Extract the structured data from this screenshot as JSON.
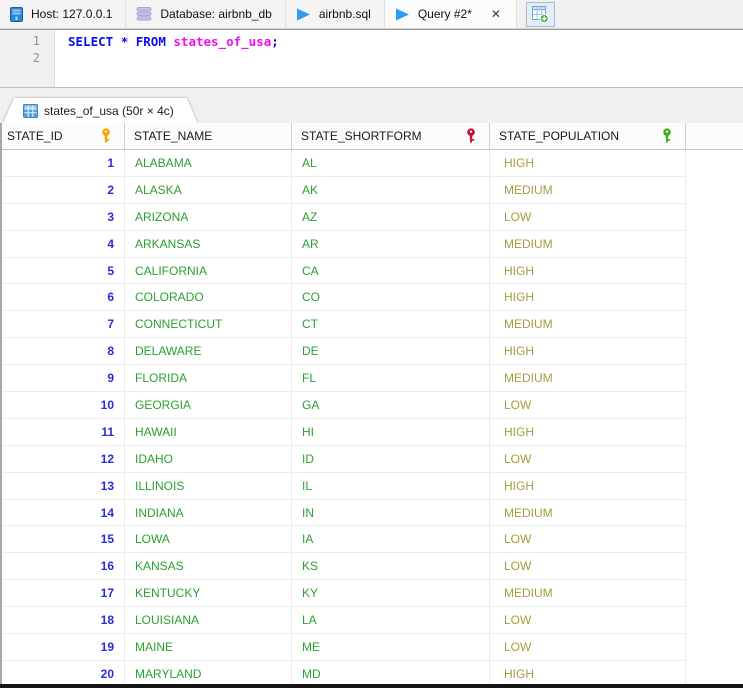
{
  "tabbar": {
    "tabs": [
      {
        "label": "Host: 127.0.0.1",
        "icon": "server-icon"
      },
      {
        "label": "Database: airbnb_db",
        "icon": "database-icon"
      },
      {
        "label": "airbnb.sql",
        "icon": "play-icon"
      },
      {
        "label": "Query #2*",
        "icon": "play-icon",
        "active": true
      }
    ],
    "close_glyph": "✕"
  },
  "editor": {
    "line_numbers": [
      "1",
      "2"
    ],
    "sql_text": "SELECT * FROM states_of_usa;",
    "sql_tokens": [
      {
        "text": "SELECT",
        "type": "keyword"
      },
      {
        "text": " ",
        "type": "plain"
      },
      {
        "text": "*",
        "type": "keyword"
      },
      {
        "text": " ",
        "type": "plain"
      },
      {
        "text": "FROM",
        "type": "keyword"
      },
      {
        "text": " ",
        "type": "plain"
      },
      {
        "text": "states_of_usa",
        "type": "identifier"
      },
      {
        "text": ";",
        "type": "keyword"
      }
    ],
    "colors": {
      "keyword": "#0b0bf0",
      "identifier": "#ee10ee"
    }
  },
  "result_tab": {
    "label": "states_of_usa (50r × 4c)"
  },
  "grid": {
    "columns": [
      {
        "header": "STATE_ID",
        "key_color": "#f5a300",
        "align": "right",
        "text_color": "#2a2ae0",
        "bold": true
      },
      {
        "header": "STATE_NAME",
        "key_color": null,
        "align": "left",
        "text_color": "#2aa12e",
        "bold": false
      },
      {
        "header": "STATE_SHORTFORM",
        "key_color": "#c41230",
        "align": "left",
        "text_color": "#2aa12e",
        "bold": false
      },
      {
        "header": "STATE_POPULATION",
        "key_color": "#3cb020",
        "align": "left",
        "text_color": "#a49d3e",
        "bold": false
      }
    ],
    "rows": [
      [
        "1",
        "ALABAMA",
        "AL",
        "HIGH"
      ],
      [
        "2",
        "ALASKA",
        "AK",
        "MEDIUM"
      ],
      [
        "3",
        "ARIZONA",
        "AZ",
        "LOW"
      ],
      [
        "4",
        "ARKANSAS",
        "AR",
        "MEDIUM"
      ],
      [
        "5",
        "CALIFORNIA",
        "CA",
        "HIGH"
      ],
      [
        "6",
        "COLORADO",
        "CO",
        "HIGH"
      ],
      [
        "7",
        "CONNECTICUT",
        "CT",
        "MEDIUM"
      ],
      [
        "8",
        "DELAWARE",
        "DE",
        "HIGH"
      ],
      [
        "9",
        "FLORIDA",
        "FL",
        "MEDIUM"
      ],
      [
        "10",
        "GEORGIA",
        "GA",
        "LOW"
      ],
      [
        "11",
        "HAWAII",
        "HI",
        "HIGH"
      ],
      [
        "12",
        "IDAHO",
        "ID",
        "LOW"
      ],
      [
        "13",
        "ILLINOIS",
        "IL",
        "HIGH"
      ],
      [
        "14",
        "INDIANA",
        "IN",
        "MEDIUM"
      ],
      [
        "15",
        "LOWA",
        "IA",
        "LOW"
      ],
      [
        "16",
        "KANSAS",
        "KS",
        "LOW"
      ],
      [
        "17",
        "KENTUCKY",
        "KY",
        "MEDIUM"
      ],
      [
        "18",
        "LOUISIANA",
        "LA",
        "LOW"
      ],
      [
        "19",
        "MAINE",
        "ME",
        "LOW"
      ],
      [
        "20",
        "MARYLAND",
        "MD",
        "HIGH"
      ]
    ]
  }
}
